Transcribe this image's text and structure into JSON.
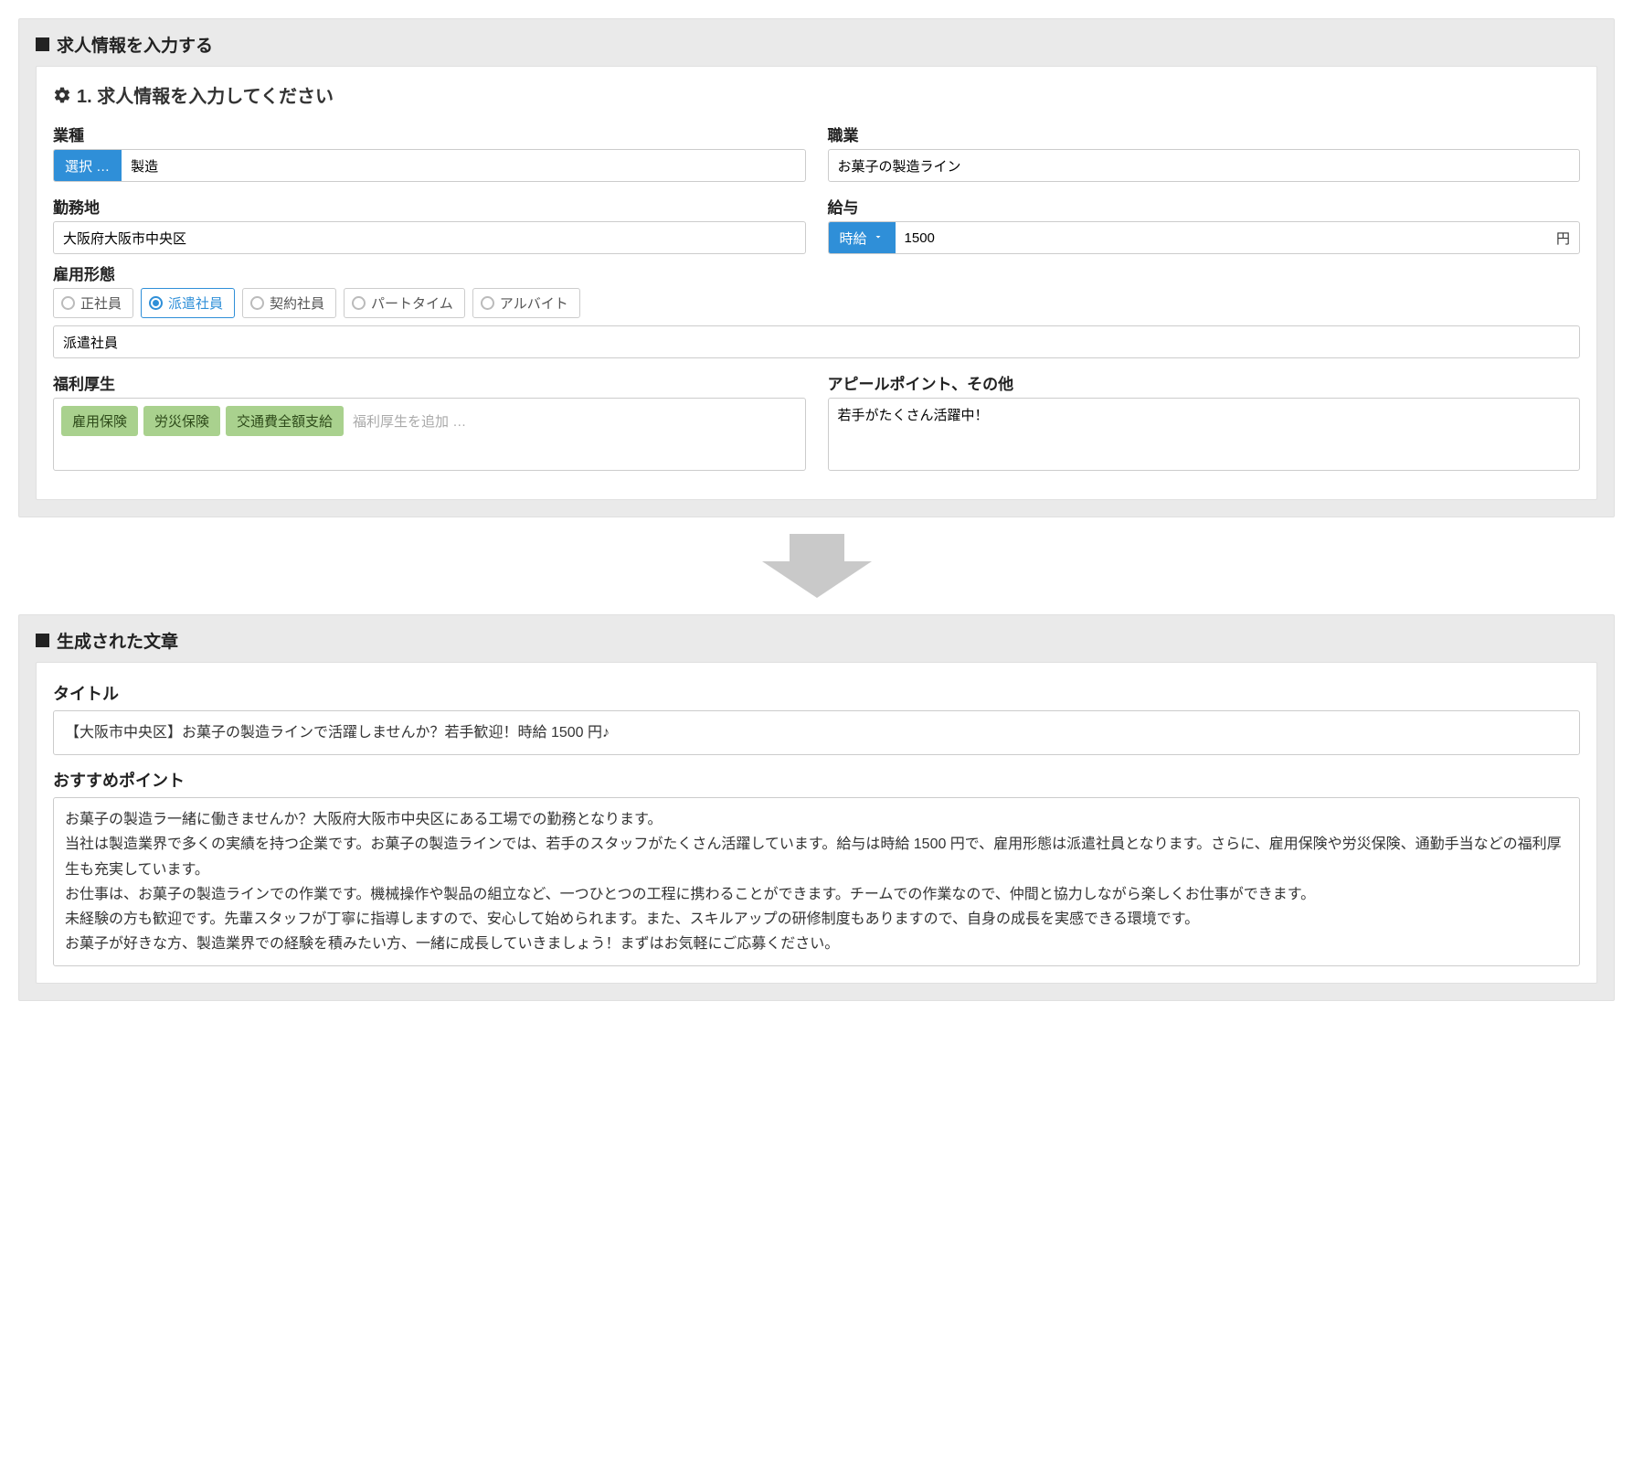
{
  "input_panel": {
    "header": "求人情報を入力する",
    "section_title": "1. 求人情報を入力してください",
    "industry": {
      "label": "業種",
      "prefix": "選択 …",
      "value": "製造"
    },
    "occupation": {
      "label": "職業",
      "value": "お菓子の製造ライン"
    },
    "location": {
      "label": "勤務地",
      "value": "大阪府大阪市中央区"
    },
    "salary": {
      "label": "給与",
      "prefix": "時給",
      "value": "1500",
      "suffix": "円"
    },
    "employment_type": {
      "label": "雇用形態",
      "options": [
        "正社員",
        "派遣社員",
        "契約社員",
        "パートタイム",
        "アルバイト"
      ],
      "selected_index": 1,
      "value": "派遣社員"
    },
    "benefits": {
      "label": "福利厚生",
      "tags": [
        "雇用保険",
        "労災保険",
        "交通費全額支給"
      ],
      "placeholder": "福利厚生を追加 …"
    },
    "appeal": {
      "label": "アピールポイント、その他",
      "value": "若手がたくさん活躍中！"
    }
  },
  "output_panel": {
    "header": "生成された文章",
    "title_label": "タイトル",
    "title_value": "【大阪市中央区】お菓子の製造ラインで活躍しませんか？若手歓迎！時給 1500 円♪",
    "points_label": "おすすめポイント",
    "points_value": "お菓子の製造ラ一緒に働きませんか？大阪府大阪市中央区にある工場での勤務となります。\n当社は製造業界で多くの実績を持つ企業です。お菓子の製造ラインでは、若手のスタッフがたくさん活躍しています。給与は時給 1500 円で、雇用形態は派遣社員となります。さらに、雇用保険や労災保険、通勤手当などの福利厚生も充実しています。\nお仕事は、お菓子の製造ラインでの作業です。機械操作や製品の組立など、一つひとつの工程に携わることができます。チームでの作業なので、仲間と協力しながら楽しくお仕事ができます。\n未経験の方も歓迎です。先輩スタッフが丁寧に指導しますので、安心して始められます。また、スキルアップの研修制度もありますので、自身の成長を実感できる環境です。\nお菓子が好きな方、製造業界での経験を積みたい方、一緒に成長していきましょう！まずはお気軽にご応募ください。"
  }
}
